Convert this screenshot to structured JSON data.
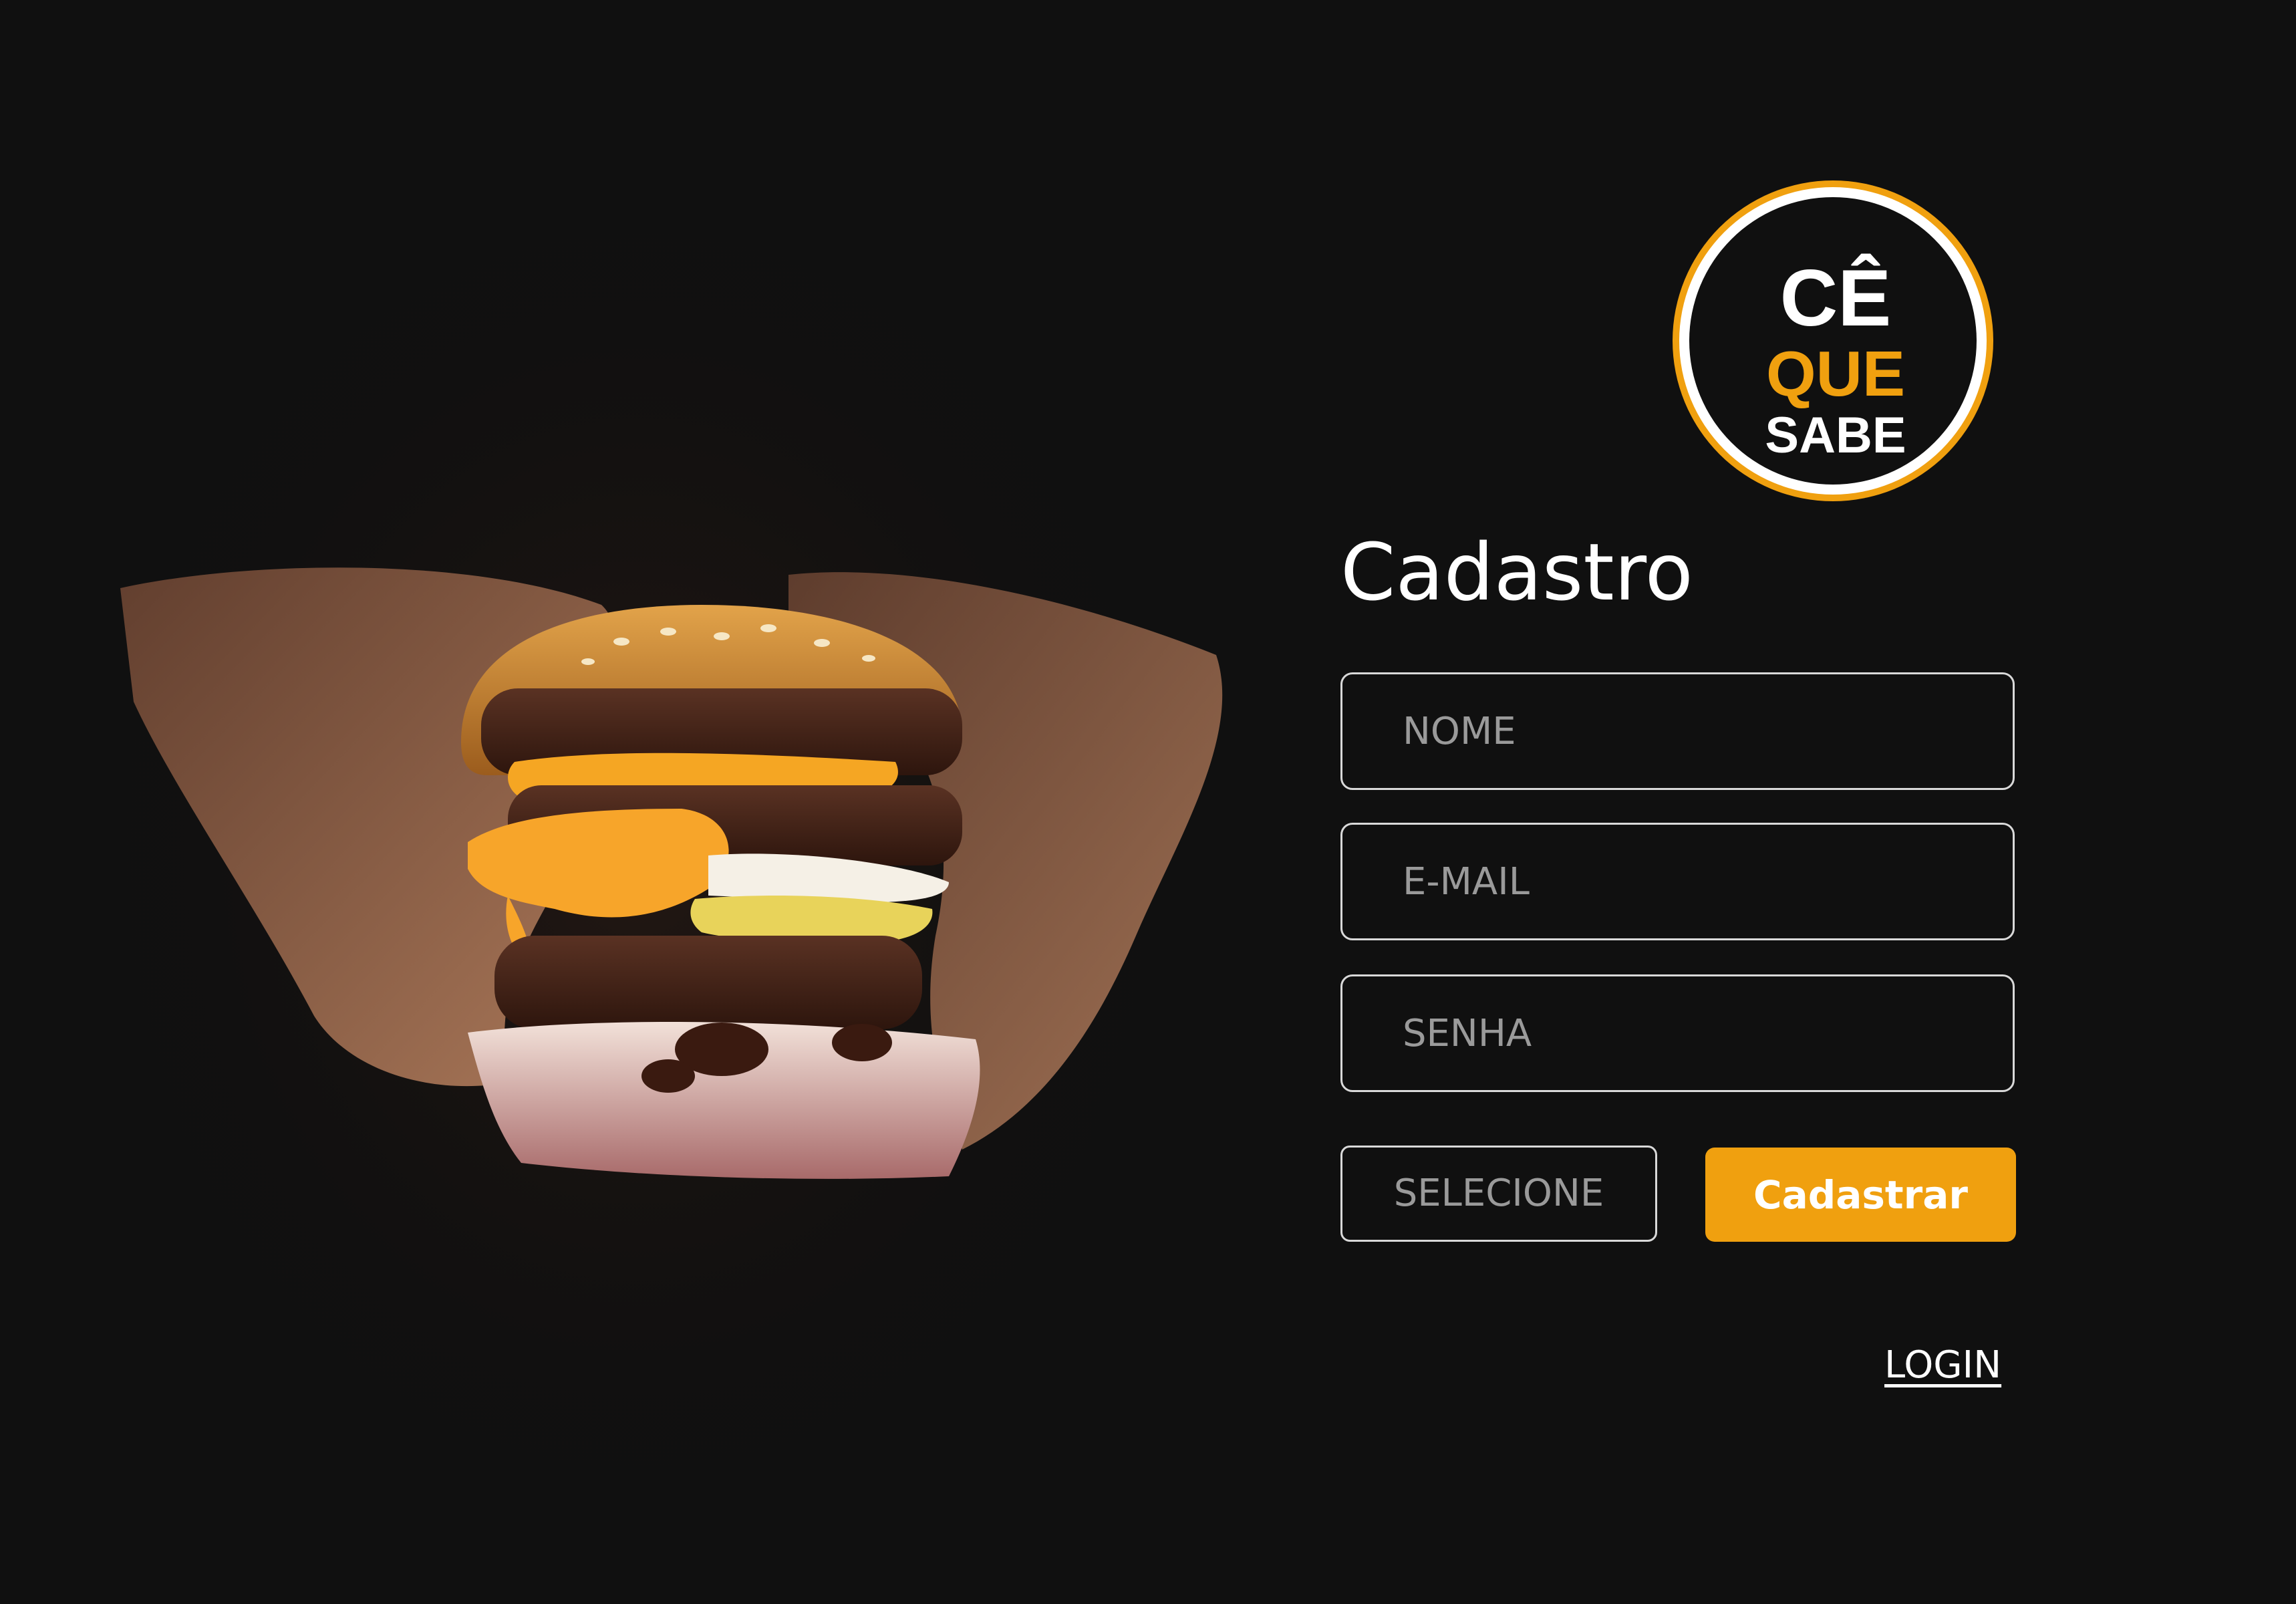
{
  "form": {
    "title": "Cadastro",
    "name_placeholder": "NOME",
    "email_placeholder": "E-MAIL",
    "password_placeholder": "SENHA",
    "select_label": "SELECIONE",
    "submit_label": "Cadastrar",
    "login_link": "LOGIN"
  },
  "logo": {
    "line1": "CÊ",
    "line2": "QUE",
    "line3": "SABE"
  },
  "colors": {
    "background": "#101010",
    "accent": "#f0a00f",
    "field_border": "#d9d9d9",
    "placeholder": "#9a9a9a",
    "text": "#ffffff"
  },
  "icons": [
    "burger-photo",
    "brand-logo"
  ]
}
